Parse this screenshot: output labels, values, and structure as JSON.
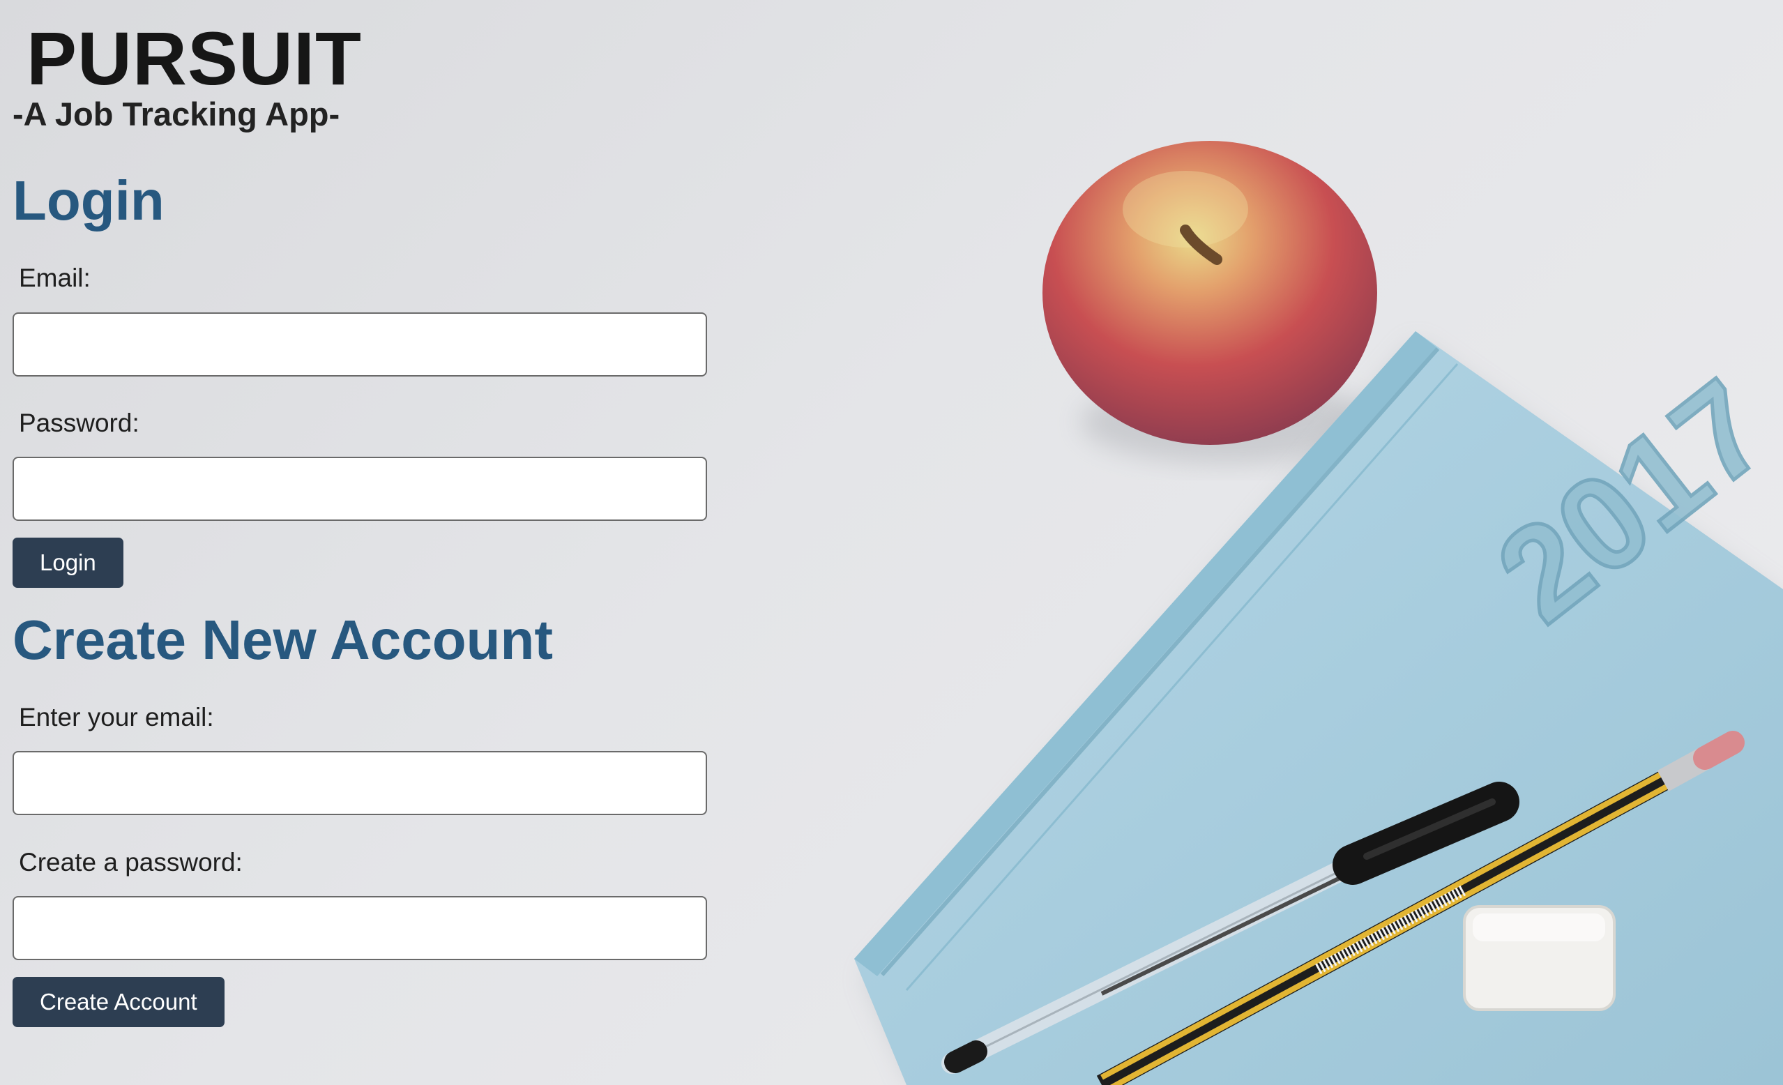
{
  "brand": {
    "title": "PURSUIT",
    "subtitle": "-A Job Tracking App-"
  },
  "login": {
    "heading": "Login",
    "email_label": "Email:",
    "email_value": "",
    "password_label": "Password:",
    "password_value": "",
    "button_label": "Login"
  },
  "signup": {
    "heading": "Create New Account",
    "email_label": "Enter your email:",
    "email_value": "",
    "password_label": "Create a password:",
    "password_value": "",
    "button_label": "Create Account"
  },
  "background": {
    "description_icons": [
      "apple-icon",
      "notebook-icon",
      "pen-icon",
      "pencil-icon",
      "eraser-icon"
    ],
    "notebook_emboss": "2017",
    "colors": {
      "backdrop": "#e1e2e5",
      "notebook": "#a7cbdc",
      "apple": "#c24a4e",
      "heading": "#27587f",
      "button": "#2d3e52"
    }
  }
}
